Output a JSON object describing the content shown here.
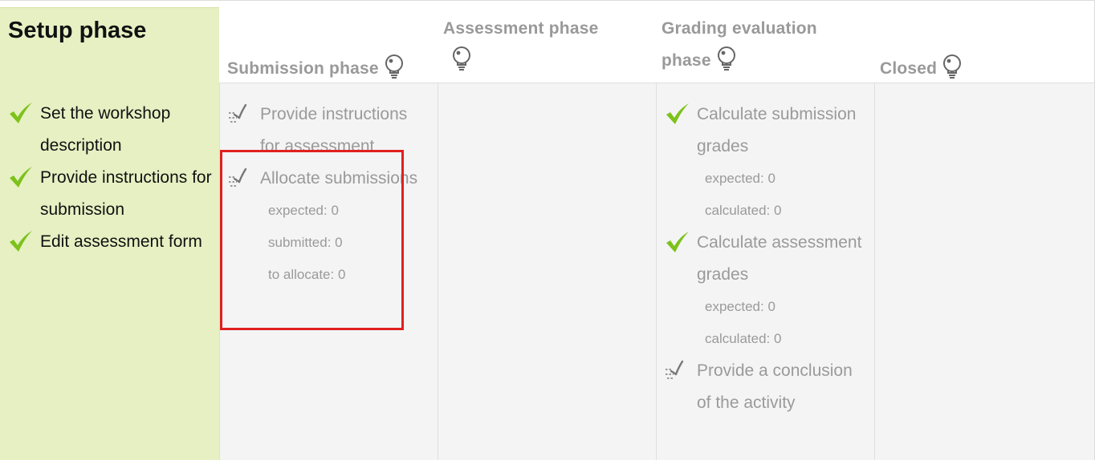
{
  "phases": {
    "setup": {
      "title": "Setup phase",
      "tasks": [
        {
          "title": "Set the workshop description",
          "status": "done"
        },
        {
          "title": "Provide instructions for submission",
          "status": "done"
        },
        {
          "title": "Edit assessment form",
          "status": "done"
        }
      ]
    },
    "submission": {
      "title": "Submission phase",
      "tasks": [
        {
          "title": "Provide instructions for assessment",
          "status": "todo"
        },
        {
          "title": "Allocate submissions",
          "status": "todo",
          "details": [
            "expected: 0",
            "submitted: 0",
            "to allocate: 0"
          ]
        }
      ]
    },
    "assessment": {
      "title": "Assessment phase"
    },
    "grading": {
      "title": "Grading evaluation phase",
      "tasks": [
        {
          "title": "Calculate submission grades",
          "status": "done",
          "details": [
            "expected: 0",
            "calculated: 0"
          ]
        },
        {
          "title": "Calculate assessment grades",
          "status": "done",
          "details": [
            "expected: 0",
            "calculated: 0"
          ]
        },
        {
          "title": "Provide a conclusion of the activity",
          "status": "todo"
        }
      ]
    },
    "closed": {
      "title": "Closed"
    }
  },
  "icons": {
    "done": "checkmark-icon",
    "todo": "todo-checklist-icon",
    "switch": "lightbulb-icon"
  },
  "colors": {
    "setup_background": "#e6f0c3",
    "done_check": "#7cc21a",
    "muted_text": "#999999",
    "highlight_border": "#e02020"
  }
}
